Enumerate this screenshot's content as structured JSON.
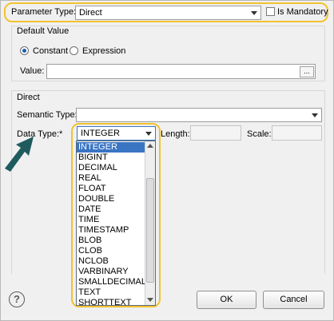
{
  "header": {
    "parameter_type_label": "Parameter Type:",
    "parameter_type_value": "Direct",
    "is_mandatory_label": "Is Mandatory"
  },
  "default_value": {
    "group_title": "Default Value",
    "constant_label": "Constant",
    "expression_label": "Expression",
    "selected": "Constant",
    "value_label": "Value:",
    "value": "",
    "browse_label": "..."
  },
  "direct": {
    "group_title": "Direct",
    "semantic_type_label": "Semantic Type:",
    "semantic_type_value": "",
    "data_type_label": "Data Type:*",
    "data_type_value": "INTEGER",
    "length_label": "Length:",
    "scale_label": "Scale:"
  },
  "dropdown": {
    "items": [
      "INTEGER",
      "BIGINT",
      "DECIMAL",
      "REAL",
      "FLOAT",
      "DOUBLE",
      "DATE",
      "TIME",
      "TIMESTAMP",
      "BLOB",
      "CLOB",
      "NCLOB",
      "VARBINARY",
      "SMALLDECIMAL",
      "TEXT",
      "SHORTTEXT"
    ],
    "selected_index": 0
  },
  "footer": {
    "help_label": "?",
    "ok_label": "OK",
    "cancel_label": "Cancel"
  },
  "colors": {
    "highlight": "#f2c230",
    "selection": "#3a75c4",
    "arrow": "#1f5b5e"
  },
  "icons": [
    "help-icon",
    "dropdown-arrow-icon",
    "pointer-arrow-icon"
  ]
}
